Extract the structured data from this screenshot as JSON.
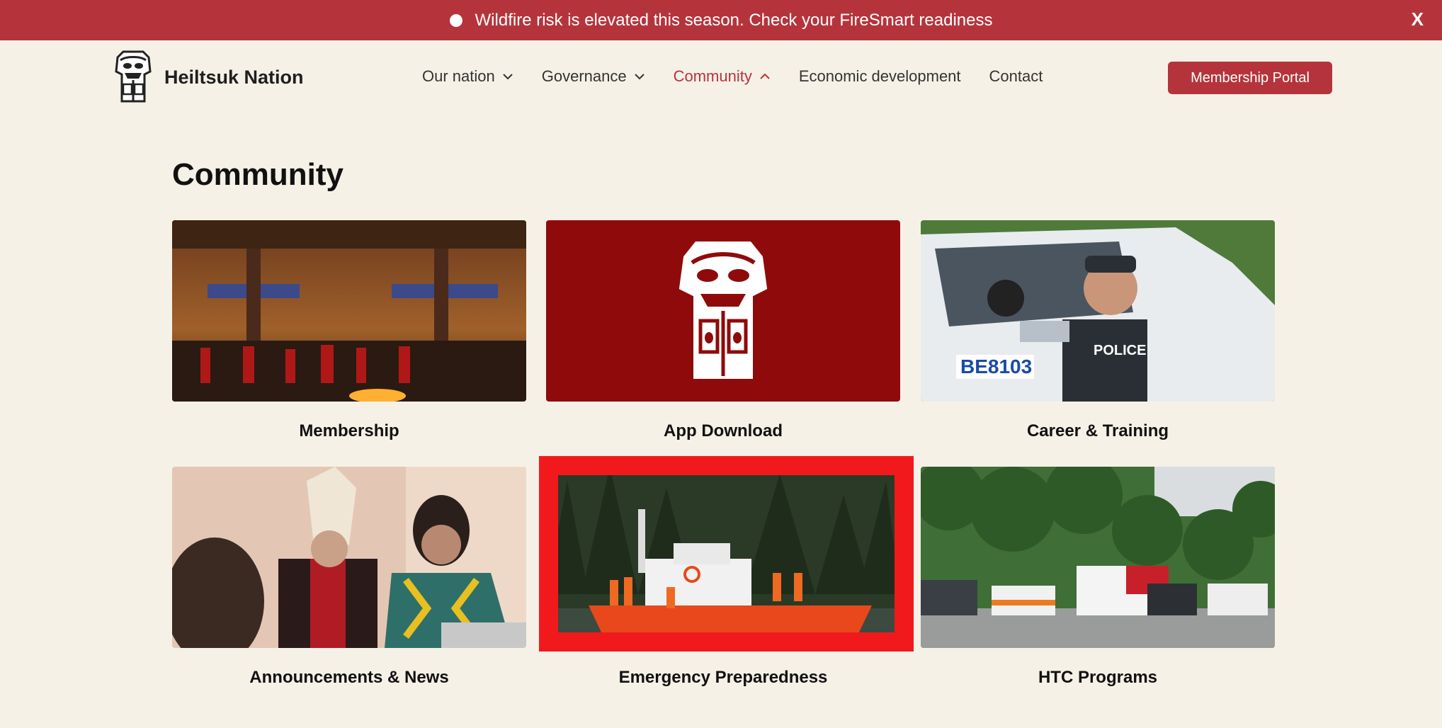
{
  "alert": {
    "text": "Wildfire risk is elevated this season. Check your FireSmart readiness",
    "close_label": "X"
  },
  "header": {
    "org_name": "Heiltsuk Nation",
    "nav": [
      {
        "label": "Our nation",
        "icon": "chevron-down-icon"
      },
      {
        "label": "Governance",
        "icon": "chevron-down-icon"
      },
      {
        "label": "Community",
        "icon": "chevron-up-icon",
        "active": true
      },
      {
        "label": "Economic development"
      },
      {
        "label": "Contact"
      }
    ],
    "portal_label": "Membership Portal"
  },
  "main": {
    "title": "Community",
    "cards": [
      {
        "label": "Membership"
      },
      {
        "label": "App Download"
      },
      {
        "label": "Career & Training"
      },
      {
        "label": "Announcements & News"
      },
      {
        "label": "Emergency Preparedness"
      },
      {
        "label": "HTC Programs"
      }
    ]
  },
  "colors": {
    "accent": "#b5343c",
    "background": "#f6f1e7",
    "highlight": "#f2191d",
    "app_tile": "#8f0b0b"
  }
}
